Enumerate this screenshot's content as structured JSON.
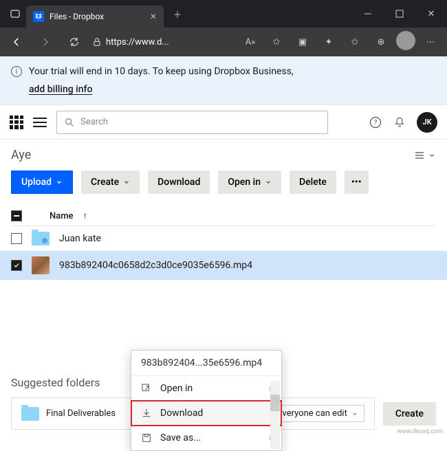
{
  "window": {
    "tab_title": "Files - Dropbox",
    "url": "https://www.d..."
  },
  "banner": {
    "text": "Your trial will end in 10 days. To keep using Dropbox Business,",
    "link": "add billing info"
  },
  "search": {
    "placeholder": "Search"
  },
  "user": {
    "initials": "JK"
  },
  "breadcrumb": "Aye",
  "actions": {
    "upload": "Upload",
    "create": "Create",
    "download": "Download",
    "open_in": "Open in",
    "delete": "Delete"
  },
  "columns": {
    "name": "Name"
  },
  "rows": [
    {
      "name": "Juan kate",
      "type": "folder",
      "checked": false
    },
    {
      "name": "983b892404c0658d2c3d0ce9035e6596.mp4",
      "type": "file",
      "checked": true
    }
  ],
  "context": {
    "title": "983b892404...35e6596.mp4",
    "items": [
      {
        "label": "Open in",
        "arrow": true
      },
      {
        "label": "Download",
        "highlight": true
      },
      {
        "label": "Save as...",
        "arrow": true
      }
    ]
  },
  "suggested": {
    "heading": "Suggested folders",
    "folder": "Final Deliverables",
    "share_label": "Everyone can edit",
    "create": "Create"
  },
  "watermark": "www.deuxq.com"
}
